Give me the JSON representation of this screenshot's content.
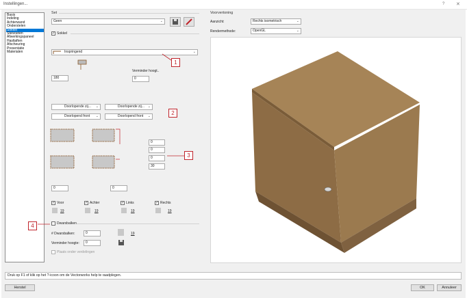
{
  "window": {
    "title": "Instellingen...",
    "help_glyph": "?",
    "close_glyph": "✕"
  },
  "nav": {
    "items": [
      "Basis",
      "Indeling",
      "Achterwand",
      "Onderstelen",
      "Sokkel",
      "Steivoeten",
      "Afwerkingspaneel",
      "Hasltaften",
      "Afscheuring",
      "Presentatie",
      "Materialen"
    ],
    "selected_index": 4
  },
  "set": {
    "label": "Set",
    "value": "Geen"
  },
  "sokkel": {
    "label": "Sokkel",
    "checked": true,
    "check_glyph": "✓"
  },
  "profile": {
    "value": "Inspringend"
  },
  "height": {
    "value": "180",
    "reduce_label": "Verminder hoogt..",
    "reduce_value": "0"
  },
  "joints": {
    "left_side": "Doorlopende zij...",
    "right_side": "Doorlopende zij...",
    "left_front": "Doorlopend front",
    "right_front": "Doorlopend front"
  },
  "offsets": [
    "0",
    "0",
    "0",
    "30"
  ],
  "bottom_values": [
    "0",
    "0"
  ],
  "sides": [
    {
      "label": "Voor",
      "checked": true,
      "count": "19"
    },
    {
      "label": "Achter",
      "checked": true,
      "count": "19"
    },
    {
      "label": "Links",
      "checked": true,
      "count": "19"
    },
    {
      "label": "Rechts",
      "checked": true,
      "count": "19"
    }
  ],
  "crossbeams": {
    "label": "Dwarsbalken",
    "checked": false,
    "count_label": "# Dwarsbalken:",
    "count_value": "0",
    "count_number": "19",
    "reduce_label": "Verminder hoogte:",
    "reduce_value": "0",
    "place_below_label": "Plaats onder verdelingen"
  },
  "preview": {
    "label": "Voorvertoning",
    "view_label": "Aanzicht:",
    "view_value": "Rechts isometrisch",
    "render_label": "Rendermethode:",
    "render_value": "OpenGL"
  },
  "callouts": [
    "1",
    "2",
    "3",
    "4"
  ],
  "hint": "Druk op F1 of klik op het ?-icoon om de Vectorworks help te raadplegen.",
  "buttons": {
    "reset": "Herstel",
    "ok": "OK",
    "cancel": "Annuleer"
  },
  "colors": {
    "accent": "#0078d7",
    "callout": "#c0242b",
    "wood": "#9b7a4f"
  }
}
